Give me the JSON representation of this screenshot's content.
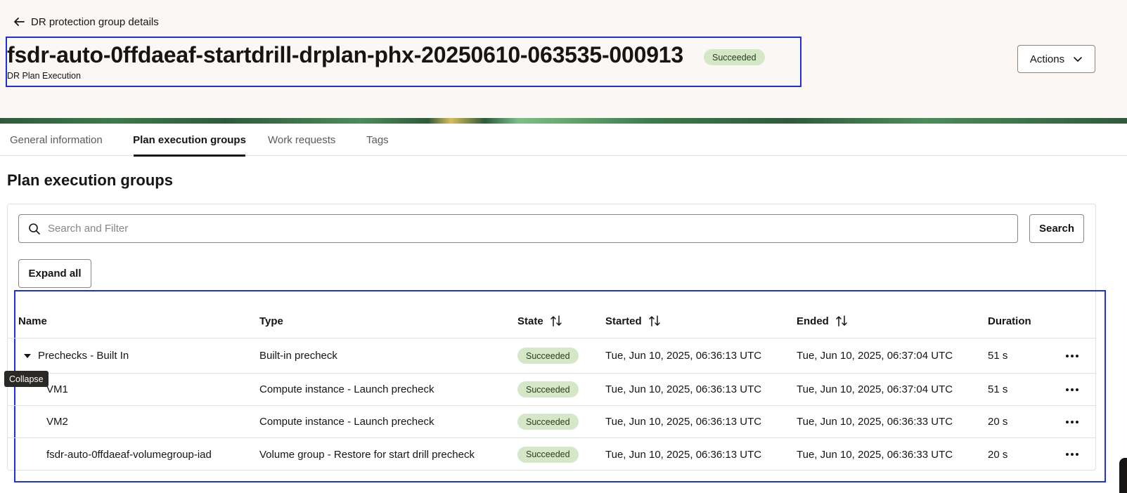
{
  "header": {
    "back_label": "DR protection group details",
    "title": "fsdr-auto-0ffdaeaf-startdrill-drplan-phx-20250610-063535-000913",
    "status": "Succeeded",
    "subtitle": "DR Plan Execution",
    "actions_label": "Actions"
  },
  "tabs": [
    {
      "label": "General information",
      "active": false
    },
    {
      "label": "Plan execution groups",
      "active": true
    },
    {
      "label": "Work requests",
      "active": false
    },
    {
      "label": "Tags",
      "active": false
    }
  ],
  "section": {
    "title": "Plan execution groups",
    "search_placeholder": "Search and Filter",
    "search_button": "Search",
    "expand_all": "Expand all"
  },
  "table": {
    "columns": {
      "name": "Name",
      "type": "Type",
      "state": "State",
      "started": "Started",
      "ended": "Ended",
      "duration": "Duration"
    },
    "rows": [
      {
        "name": "Prechecks - Built In",
        "type": "Built-in precheck",
        "state": "Succeeded",
        "started": "Tue, Jun 10, 2025, 06:36:13 UTC",
        "ended": "Tue, Jun 10, 2025, 06:37:04 UTC",
        "duration": "51 s"
      },
      {
        "name": "VM1",
        "type": "Compute instance - Launch precheck",
        "state": "Succeeded",
        "started": "Tue, Jun 10, 2025, 06:36:13 UTC",
        "ended": "Tue, Jun 10, 2025, 06:37:04 UTC",
        "duration": "51 s"
      },
      {
        "name": "VM2",
        "type": "Compute instance - Launch precheck",
        "state": "Succeeded",
        "started": "Tue, Jun 10, 2025, 06:36:13 UTC",
        "ended": "Tue, Jun 10, 2025, 06:36:33 UTC",
        "duration": "20 s"
      },
      {
        "name": "fsdr-auto-0ffdaeaf-volumegroup-iad",
        "type": "Volume group - Restore for start drill precheck",
        "state": "Succeeded",
        "started": "Tue, Jun 10, 2025, 06:36:13 UTC",
        "ended": "Tue, Jun 10, 2025, 06:36:33 UTC",
        "duration": "20 s"
      }
    ]
  },
  "tooltip": {
    "text": "Collapse"
  },
  "colors": {
    "accent_border": "#1f2fe6",
    "success_badge": "#d4e8c8",
    "header_bg": "#fbf7f5"
  }
}
